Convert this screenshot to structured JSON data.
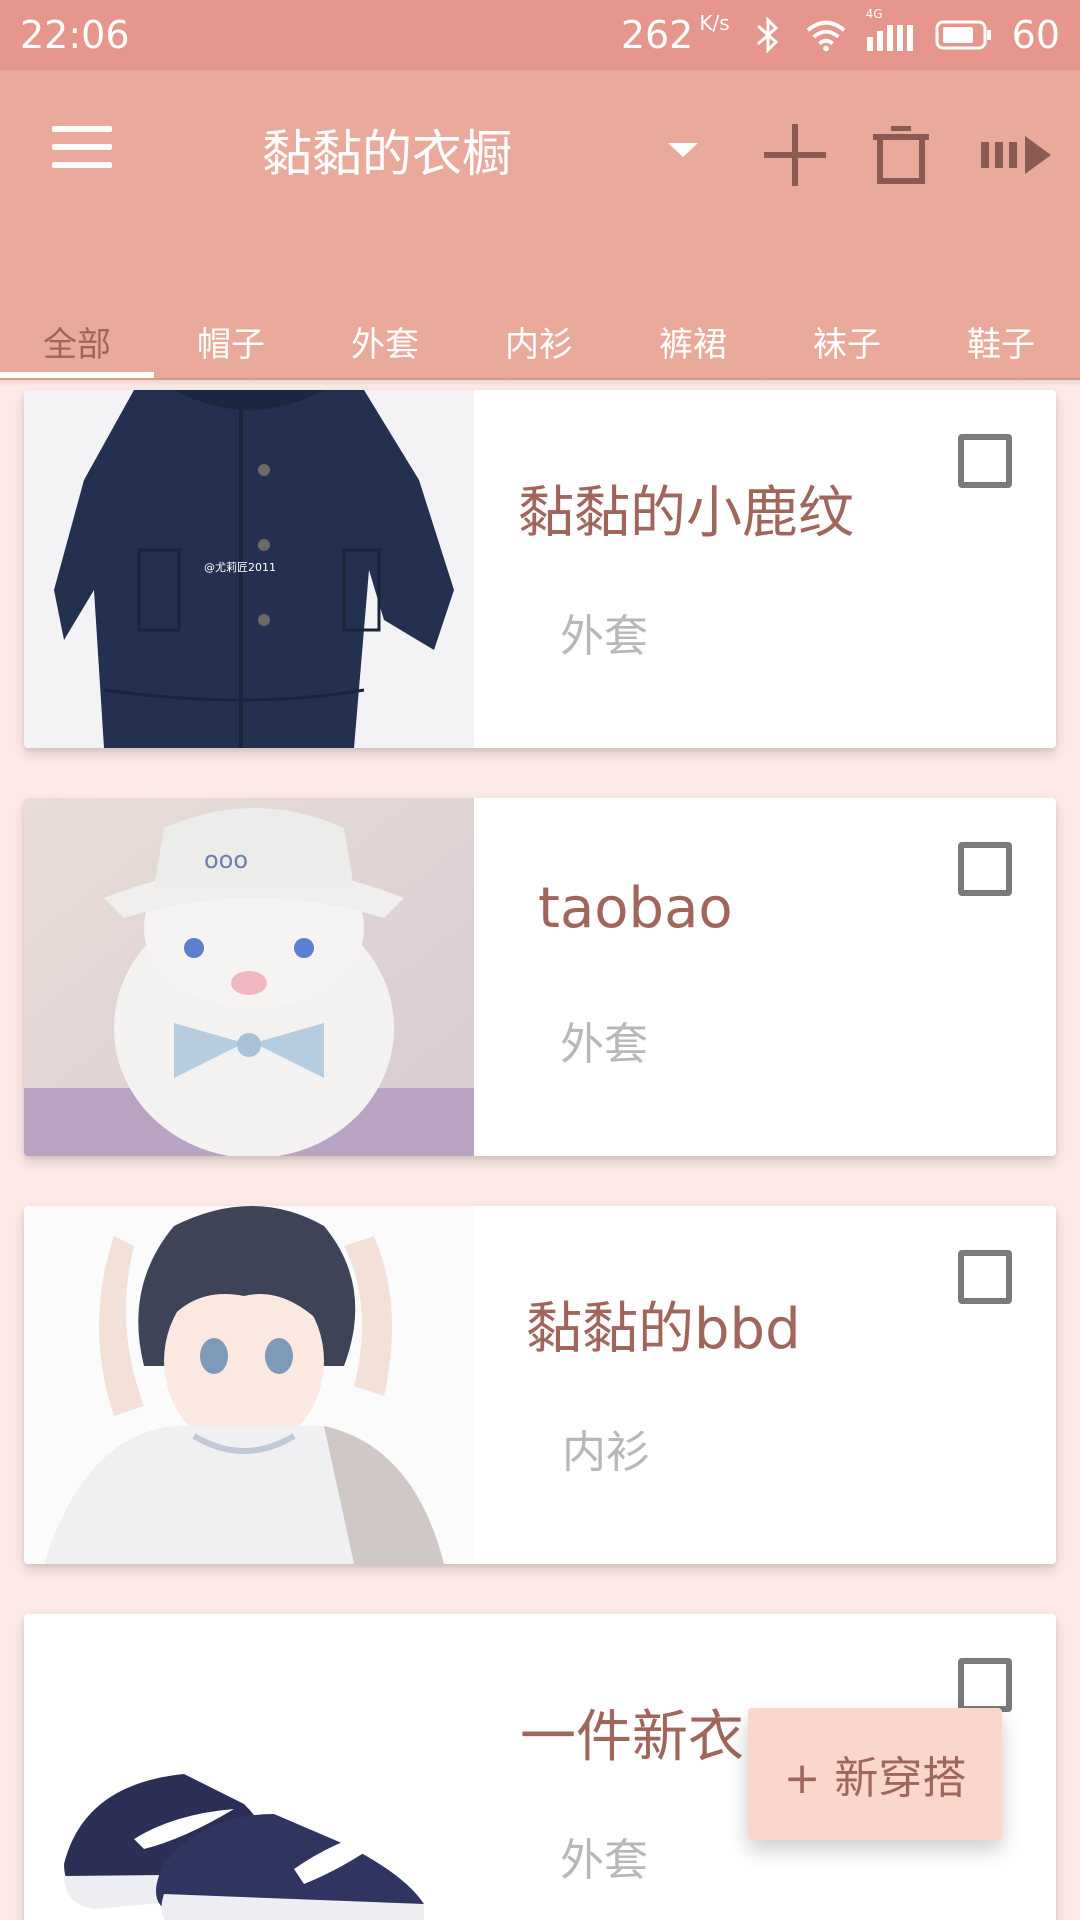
{
  "status_bar": {
    "time": "22:06",
    "net_speed": "262",
    "net_speed_unit": "K/s",
    "battery": "60",
    "network_type": "4G",
    "icons": [
      "bluetooth-icon",
      "wifi-icon",
      "signal-icon",
      "battery-icon"
    ]
  },
  "app_bar": {
    "title": "黏黏的衣橱",
    "actions": [
      "add-icon",
      "delete-icon",
      "next-icon"
    ]
  },
  "tabs": [
    {
      "label": "全部",
      "active": true
    },
    {
      "label": "帽子"
    },
    {
      "label": "外套"
    },
    {
      "label": "内衫"
    },
    {
      "label": "裤裙"
    },
    {
      "label": "袜子"
    },
    {
      "label": "鞋子"
    }
  ],
  "items": [
    {
      "name": "黏黏的小鹿纹",
      "category": "外套",
      "checked": false,
      "image_watermark": "@尤莉匠2011"
    },
    {
      "name": "taobao",
      "category": "外套",
      "checked": false
    },
    {
      "name": "黏黏的bbd",
      "category": "内衫",
      "checked": false
    },
    {
      "name": "一件新衣",
      "category": "外套",
      "checked": false
    }
  ],
  "fab": {
    "label": "+ 新穿搭"
  },
  "colors": {
    "status_bar": "#e6968c",
    "app_bar": "#eaaa9b",
    "background": "#fde9e6",
    "accent_text": "#a0665c",
    "fab": "#fbd6cd"
  }
}
